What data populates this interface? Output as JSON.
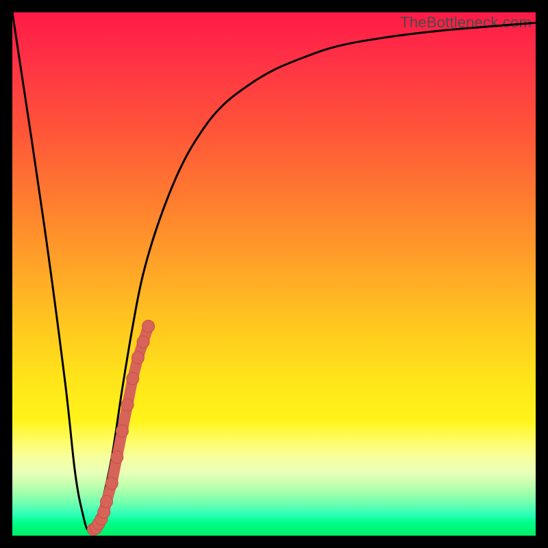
{
  "watermark": "TheBottleneck.com",
  "colors": {
    "frame": "#000000",
    "curve_stroke": "#000000",
    "marker_fill": "#d66459",
    "marker_stroke": "#c54f44",
    "gradient_top": "#ff1a46",
    "gradient_bottom": "#00ee66"
  },
  "chart_data": {
    "type": "line",
    "title": "",
    "xlabel": "",
    "ylabel": "",
    "xlim": [
      0,
      100
    ],
    "ylim": [
      0,
      100
    ],
    "series": [
      {
        "name": "black-v-curve",
        "x": [
          0,
          6,
          10,
          12,
          13.5,
          14.5,
          15.5,
          17,
          19,
          21,
          23,
          25,
          28,
          32,
          36,
          40,
          45,
          50,
          56,
          62,
          70,
          80,
          90,
          100
        ],
        "y": [
          100,
          60,
          30,
          12,
          4,
          1,
          2,
          6,
          15,
          28,
          40,
          50,
          60,
          70,
          77,
          82,
          86,
          89,
          91.5,
          93.5,
          95,
          96.3,
          97.2,
          98
        ]
      }
    ],
    "markers": {
      "name": "red-segment",
      "description": "Short salmon marker points near the valley, rising along right branch",
      "x": [
        15.5,
        16,
        16.5,
        17,
        17.5,
        18,
        19,
        20,
        21,
        22,
        23,
        24,
        25,
        26
      ],
      "y": [
        1.2,
        1.5,
        2.3,
        3.2,
        4.5,
        6.5,
        10,
        15,
        20,
        25,
        30,
        34,
        37,
        40
      ]
    }
  }
}
